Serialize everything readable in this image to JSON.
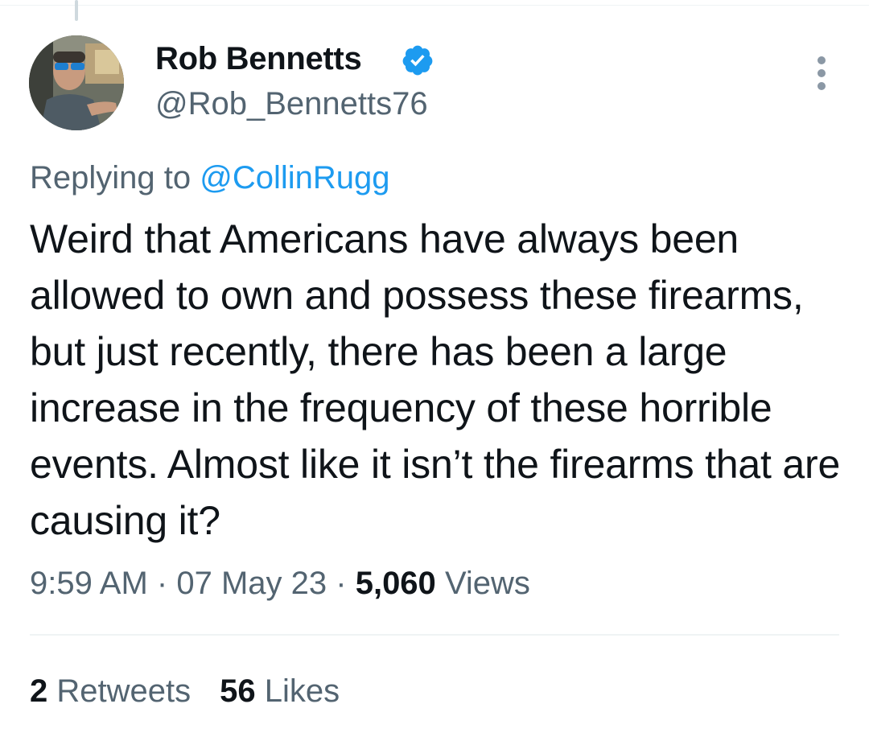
{
  "tweet": {
    "author": {
      "display_name": "Rob Bennetts",
      "handle": "@Rob_Bennetts76",
      "verified_icon": "verified-badge-icon",
      "avatar": "profile-photo"
    },
    "more_icon": "more-options-icon",
    "reply_context": {
      "prefix": "Replying to",
      "mention": "@CollinRugg"
    },
    "text": "Weird that Americans have always been allowed to own and possess these firearms, but just recently, there has been a large increase in the frequency of these horrible events. Almost like it isn’t the firearms that are causing it?",
    "time": "9:59 AM",
    "separator": "·",
    "date": "07 May 23",
    "views_count": "5,060",
    "views_label": "Views",
    "retweets_count": "2",
    "retweets_label": "Retweets",
    "likes_count": "56",
    "likes_label": "Likes"
  },
  "colors": {
    "text_primary": "#0f1419",
    "text_secondary": "#536471",
    "accent": "#1d9bf0",
    "divider": "#eff3f4"
  }
}
